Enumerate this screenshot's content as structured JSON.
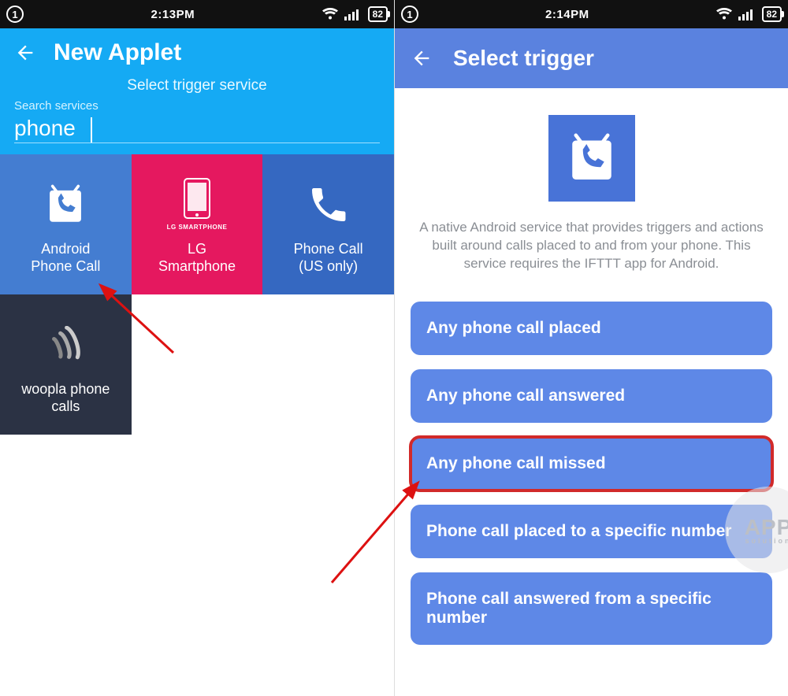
{
  "left": {
    "status": {
      "sim": "1",
      "time": "2:13PM",
      "battery": "82"
    },
    "header": {
      "title": "New Applet",
      "subtitle": "Select trigger service"
    },
    "search": {
      "label": "Search services",
      "value": "phone"
    },
    "services": [
      {
        "id": "android-phone-call",
        "label": "Android\nPhone Call",
        "color": "tile-blue",
        "icon": "android-phone"
      },
      {
        "id": "lg-smartphone",
        "label": "LG\nSmartphone",
        "sublabel": "LG SMARTPHONE",
        "color": "tile-pink",
        "icon": "lg-phone"
      },
      {
        "id": "phone-call-us",
        "label": "Phone Call\n(US only)",
        "color": "tile-blue2",
        "icon": "phone-handset"
      },
      {
        "id": "woopla",
        "label": "woopla phone\ncalls",
        "color": "tile-dark",
        "icon": "woopla"
      }
    ]
  },
  "right": {
    "status": {
      "sim": "1",
      "time": "2:14PM",
      "battery": "82"
    },
    "header": {
      "title": "Select trigger"
    },
    "description": "A native Android service that provides triggers and actions built around calls placed to and from your phone. This service requires the IFTTT app for Android.",
    "triggers": [
      {
        "label": "Any phone call placed",
        "highlight": false
      },
      {
        "label": "Any phone call answered",
        "highlight": false
      },
      {
        "label": "Any phone call missed",
        "highlight": true
      },
      {
        "label": "Phone call placed to a specific number",
        "highlight": false
      },
      {
        "label": "Phone call answered from a specific number",
        "highlight": false
      }
    ]
  },
  "watermark": {
    "line1": "APP",
    "line2": "solution"
  }
}
